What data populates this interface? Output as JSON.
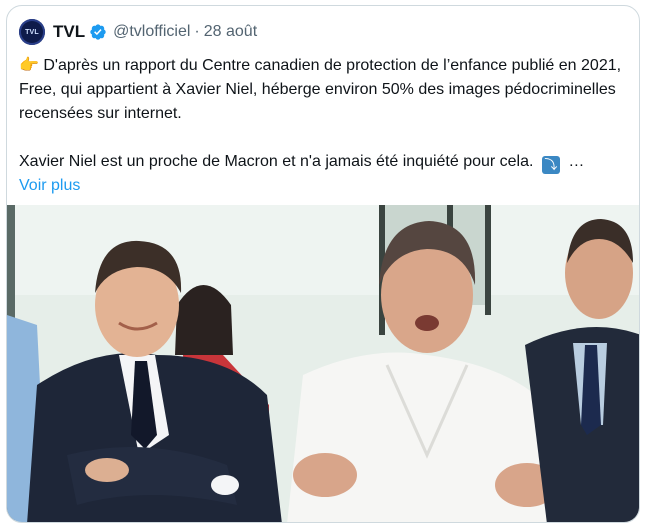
{
  "tweet": {
    "author_name": "TVL",
    "avatar_text": "TVL",
    "handle": "@tvlofficiel",
    "separator": "·",
    "date": "28 août",
    "pointing_emoji": "👉",
    "paragraph_1": "D'après un rapport du Centre canadien de protection de l’enfance publié en 2021, Free, qui appartient à Xavier Niel, héberge environ 50% des images pédocriminelles recensées sur internet.",
    "paragraph_2": "Xavier Niel est un proche de Macron et n'a jamais été inquiété pour cela.",
    "arrow_emoji": "⤵",
    "ellipsis": "…",
    "show_more": "Voir plus"
  },
  "colors": {
    "text": "#0f1419",
    "secondary": "#536471",
    "link": "#1d9bf0",
    "verified_badge": "#1d9bf0",
    "border": "#cfd9de"
  },
  "icons": {
    "verified": "verified-badge-icon",
    "pointing": "backhand-index-pointing-right",
    "arrow": "right-arrow-curving-down"
  },
  "media": {
    "type": "photo"
  }
}
